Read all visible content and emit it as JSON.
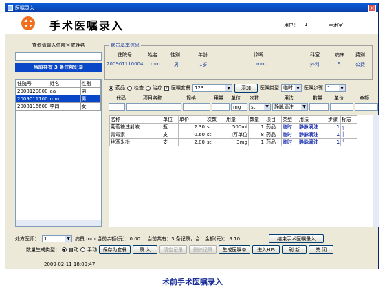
{
  "window": {
    "title": "医嘱录入",
    "close": "×"
  },
  "banner": {
    "title": "手术医嘱录入",
    "user_label": "用户：",
    "user": "1",
    "dept": "手术室"
  },
  "left": {
    "query_label": "查询请输入住院号或姓名",
    "query_value": "",
    "count_text": "当前共有 3 条住院记录",
    "columns": [
      "住院号",
      "姓名",
      "性别"
    ],
    "rows": [
      [
        "2008120800",
        "aa",
        "男"
      ],
      [
        "2009011100",
        "mm",
        "男"
      ],
      [
        "2008116600",
        "李四",
        "女"
      ]
    ],
    "selected_row": 1
  },
  "patient": {
    "group_title": "病员基本信息",
    "headers": [
      "住院号",
      "姓名",
      "性别",
      "年龄",
      "诊断",
      "科室",
      "病床",
      "费别"
    ],
    "values": [
      "200901110004",
      "mm",
      "男",
      "1岁",
      "mm",
      "外科",
      "9",
      "公费"
    ]
  },
  "controls": {
    "radios": [
      "药品",
      "检查",
      "治疗"
    ],
    "selected_radio": 0,
    "set_label": "医嘱套餐",
    "set_checked": true,
    "set_value": "123",
    "add_button": "添加",
    "order_type_label": "医嘱类型",
    "order_type_value": "临时",
    "step_label": "医嘱步骤",
    "step_value": "1"
  },
  "entry": {
    "headers": [
      "代码",
      "项目名称",
      "规格",
      "用量",
      "单位",
      "次数",
      "用法",
      "数量",
      "单价",
      "金额"
    ],
    "unit_value": "mg",
    "times_value": "st",
    "usage_value": "静脉滴注"
  },
  "grid": {
    "columns": [
      "名称",
      "单位",
      "单价",
      "次数",
      "用量",
      "数量",
      "项目",
      "类型",
      "用法",
      "步骤",
      "标志"
    ],
    "rows": [
      [
        "葡萄糖注射液",
        "瓶",
        "2.30",
        "st",
        "500ml",
        "1",
        "药品",
        "临时",
        "静脉滴注",
        "1",
        "┐"
      ],
      [
        "青霉素",
        "支",
        "0.60",
        "st",
        "J万单位",
        "8",
        "药品",
        "临时",
        "静脉滴注",
        "1",
        "│"
      ],
      [
        "地塞米松",
        "支",
        "2.00",
        "st",
        "3mg",
        "1",
        "药品",
        "临时",
        "静脉滴注",
        "1",
        "┘"
      ]
    ]
  },
  "bottom": {
    "doctor_label": "处方医师：",
    "doctor_value": "1",
    "balance_text": "病员 mm 当前余额(元)：0.00",
    "total_text": "当前共有：3 条记录，合计金额(元)： 9.10",
    "end_button": "结束手术医嘱录入",
    "qty_type_label": "数量生成类型：",
    "qty_auto": "自动",
    "qty_manual": "手动",
    "buttons": [
      "保存为套餐",
      "录  入",
      "清空记录",
      "删除记录",
      "生成医嘱单",
      "进入HIS",
      "刷  新",
      "关  闭"
    ],
    "disabled_buttons": [
      2,
      3
    ]
  },
  "status": {
    "datetime": "2009-02-11  18:09:47"
  },
  "caption": "术前手术医嘱录入"
}
